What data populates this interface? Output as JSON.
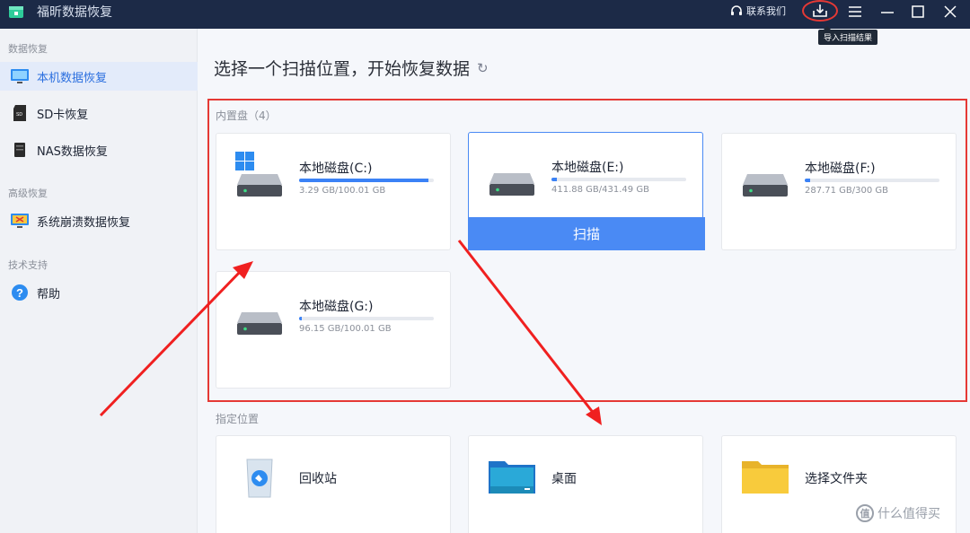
{
  "titlebar": {
    "app_title": "福昕数据恢复",
    "contact_label": "联系我们",
    "import_tooltip": "导入扫描结果"
  },
  "sidebar": {
    "section_data_recovery": "数据恢复",
    "section_advanced": "高级恢复",
    "section_support": "技术支持",
    "items": [
      {
        "label": "本机数据恢复",
        "icon": "monitor-icon",
        "active": true
      },
      {
        "label": "SD卡恢复",
        "icon": "sd-card-icon"
      },
      {
        "label": "NAS数据恢复",
        "icon": "nas-icon"
      },
      {
        "label": "系统崩溃数据恢复",
        "icon": "system-crash-icon"
      },
      {
        "label": "帮助",
        "icon": "help-icon"
      }
    ]
  },
  "main": {
    "title": "选择一个扫描位置，开始恢复数据",
    "internal_label": "内置盘（4）",
    "specified_label": "指定位置",
    "drives": [
      {
        "name": "本地磁盘(C:)",
        "size": "3.29 GB/100.01 GB",
        "fill": 0.96,
        "system": true
      },
      {
        "name": "本地磁盘(E:)",
        "size": "411.88 GB/431.49 GB",
        "fill": 0.04,
        "selected": true
      },
      {
        "name": "本地磁盘(F:)",
        "size": "287.71 GB/300 GB",
        "fill": 0.04
      },
      {
        "name": "本地磁盘(G:)",
        "size": "96.15 GB/100.01 GB",
        "fill": 0.02
      }
    ],
    "scan_label": "扫描",
    "locations": [
      {
        "name": "回收站",
        "icon": "recycle-bin-icon"
      },
      {
        "name": "桌面",
        "icon": "desktop-folder-icon"
      },
      {
        "name": "选择文件夹",
        "icon": "folder-icon"
      }
    ]
  },
  "watermark": {
    "text": "什么值得买",
    "badge": "值"
  },
  "colors": {
    "accent": "#4a8af4",
    "titlebar": "#1c2a47",
    "highlight": "#e53935"
  }
}
